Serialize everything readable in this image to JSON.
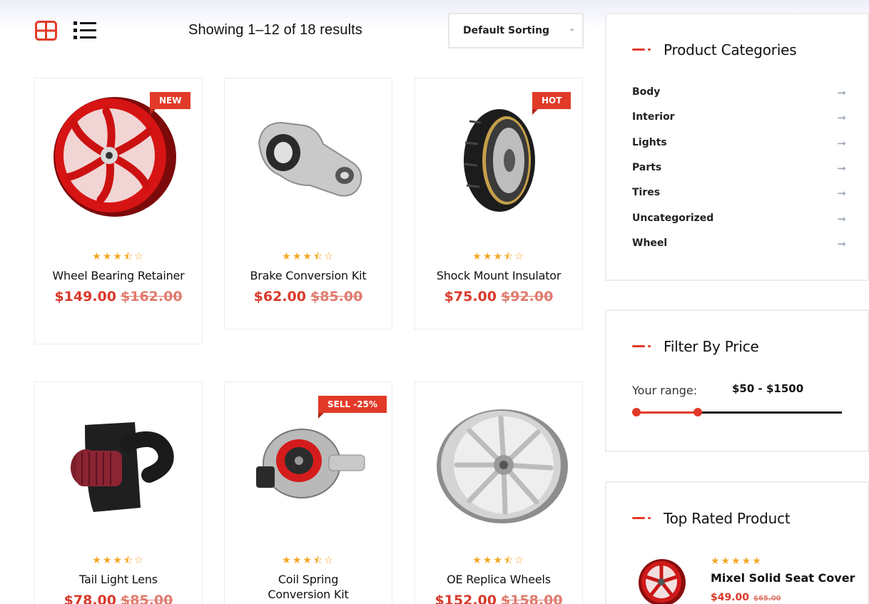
{
  "toolbar": {
    "result_count": "Showing 1–12 of 18 results",
    "sorting": "Default Sorting",
    "grid_icon": "grid-view-icon",
    "list_icon": "list-view-icon",
    "accent_color": "#e23a28"
  },
  "products": [
    {
      "title": "Wheel Bearing Retainer",
      "price": "$149.00",
      "old_price": "$162.00",
      "badge": "NEW",
      "rating": 3.5,
      "image": "red-wheel"
    },
    {
      "title": "Brake Conversion Kit",
      "price": "$62.00",
      "old_price": "$85.00",
      "badge": "",
      "rating": 3.5,
      "image": "engine-mount"
    },
    {
      "title": "Shock Mount Insulator",
      "price": "$75.00",
      "old_price": "$92.00",
      "badge": "HOT",
      "rating": 3.5,
      "image": "tire"
    },
    {
      "title": "Tail Light Lens",
      "price": "$78.00",
      "old_price": "$85.00",
      "badge": "",
      "rating": 3.5,
      "image": "air-intake"
    },
    {
      "title": "Coil Spring Conversion Kit",
      "price": "",
      "old_price": "",
      "badge": "SELL -25%",
      "rating": 3.5,
      "image": "turbocharger"
    },
    {
      "title": "OE Replica Wheels",
      "price": "$152.00",
      "old_price": "$158.00",
      "badge": "",
      "rating": 3.5,
      "image": "silver-wheel"
    }
  ],
  "sidebar": {
    "categories_title": "Product Categories",
    "categories": [
      "Body",
      "Interior",
      "Lights",
      "Parts",
      "Tires",
      "Uncategorized",
      "Wheel"
    ],
    "filter_title": "Filter By Price",
    "range_label": "Your range:",
    "range_value": "$50 - $1500",
    "slider_low_fraction": 0,
    "slider_high_fraction": 0.3,
    "top_rated_title": "Top Rated Product",
    "top_rated": {
      "name": "Mixel Solid Seat Cover",
      "price": "$49.00",
      "old_price": "$65.00",
      "rating": 5
    }
  }
}
